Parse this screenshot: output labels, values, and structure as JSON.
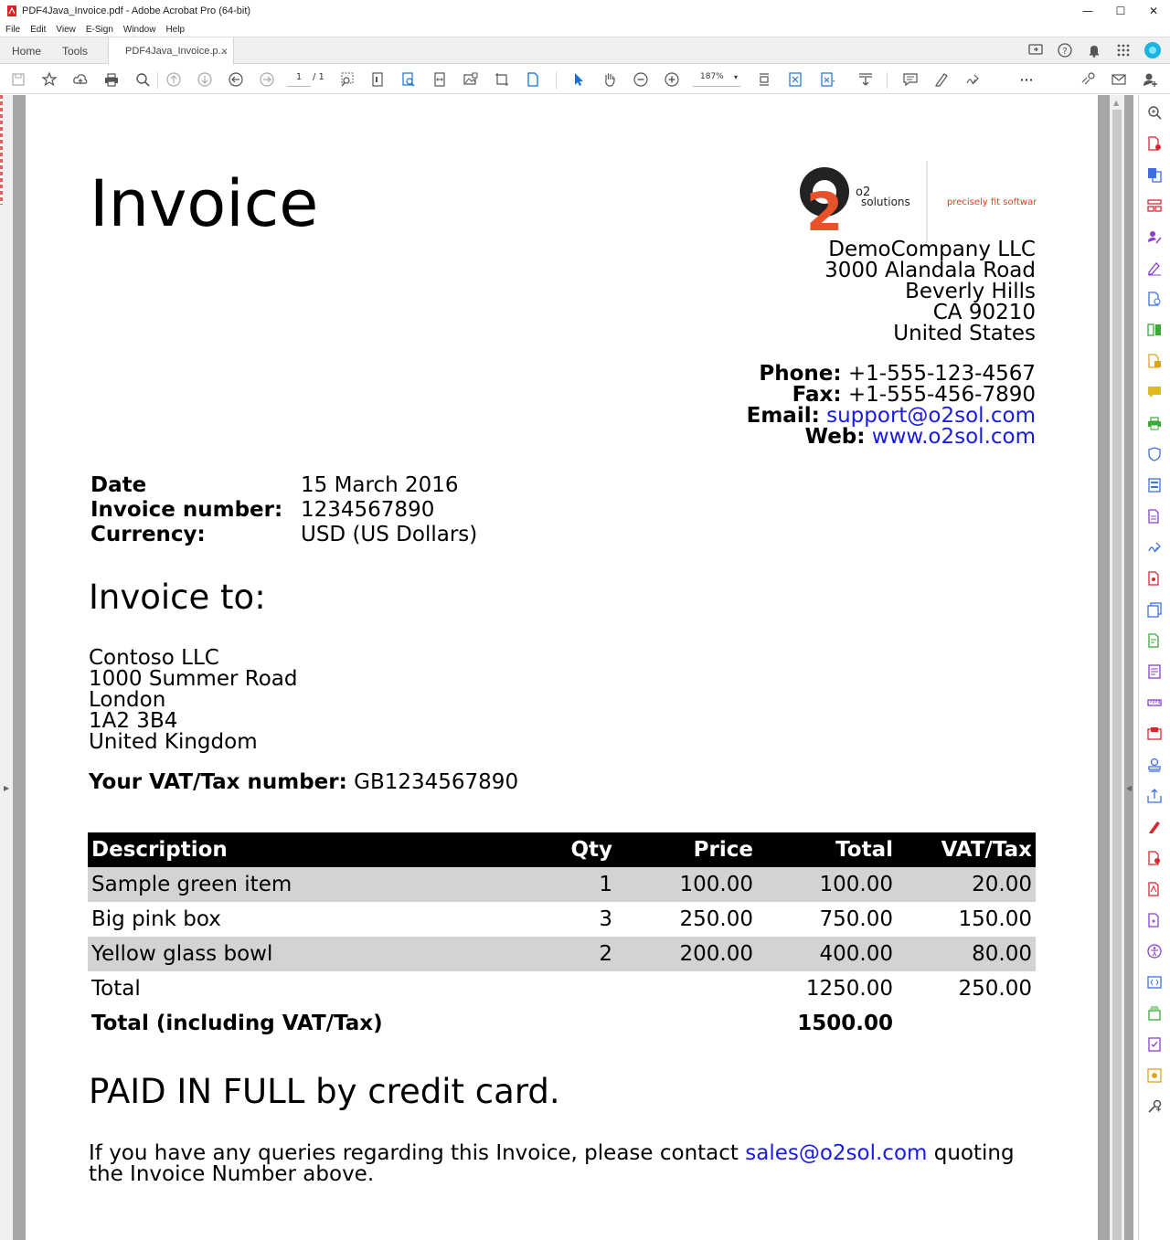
{
  "window": {
    "title": "PDF4Java_Invoice.pdf - Adobe Acrobat Pro (64-bit)",
    "minimize": "—",
    "maximize": "☐",
    "close": "✕"
  },
  "menu": [
    "File",
    "Edit",
    "View",
    "E-Sign",
    "Window",
    "Help"
  ],
  "tabs": {
    "home": "Home",
    "tools": "Tools",
    "doc": "PDF4Java_Invoice.p...",
    "doc_close": "×"
  },
  "toolbar": {
    "page_current": "1",
    "page_total": "/ 1",
    "zoom": "187%",
    "more": "···"
  },
  "colors": {
    "link": "#1a1ae6",
    "logo_orange": "#e8512a",
    "tagline_red": "#e03c1f"
  },
  "invoice": {
    "title": "Invoice",
    "logo": {
      "line1": "o2",
      "line2": "solutions",
      "tagline": "precisely fit software"
    },
    "company": [
      "DemoCompany LLC",
      "3000 Alandala Road",
      "Beverly Hills",
      "CA 90210",
      "United States"
    ],
    "contact": {
      "phone_label": "Phone:",
      "phone": "+1-555-123-4567",
      "fax_label": "Fax:",
      "fax": "+1-555-456-7890",
      "email_label": "Email:",
      "email": "support@o2sol.com",
      "web_label": "Web:",
      "web": "www.o2sol.com"
    },
    "meta": {
      "date_label": "Date",
      "date": "15 March 2016",
      "number_label": "Invoice number:",
      "number": "1234567890",
      "currency_label": "Currency:",
      "currency": "USD (US Dollars)"
    },
    "invoice_to": "Invoice to:",
    "customer": [
      "Contoso LLC",
      "1000 Summer Road",
      "London",
      "1A2 3B4",
      "United Kingdom"
    ],
    "vat_label": "Your VAT/Tax number:",
    "vat_number": "GB1234567890",
    "table": {
      "headers": [
        "Description",
        "Qty",
        "Price",
        "Total",
        "VAT/Tax"
      ],
      "rows": [
        [
          "Sample green item",
          "1",
          "100.00",
          "100.00",
          "20.00"
        ],
        [
          "Big pink box",
          "3",
          "250.00",
          "750.00",
          "150.00"
        ],
        [
          "Yellow glass bowl",
          "2",
          "200.00",
          "400.00",
          "80.00"
        ]
      ],
      "total_label": "Total",
      "total": "1250.00",
      "total_vat": "250.00",
      "grand_label": "Total (including VAT/Tax)",
      "grand_total": "1500.00"
    },
    "paid": "PAID IN FULL by credit card.",
    "query_pre": "If you have any queries regarding this Invoice, please contact",
    "query_email": "sales@o2sol.com",
    "query_post": "quoting",
    "query_line2": "the Invoice Number above."
  }
}
